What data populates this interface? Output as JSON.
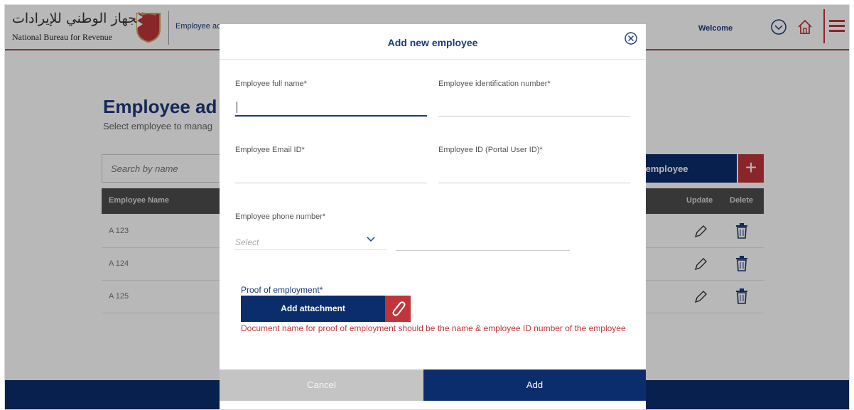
{
  "header": {
    "logo_arabic": "الجهاز الوطني للإيرادات",
    "logo_english": "National Bureau for Revenue",
    "subtitle": "Employee ac",
    "welcome": "Welcome",
    "icons": [
      "user-circle-icon",
      "home-icon",
      "hamburger-menu-icon"
    ]
  },
  "background_page": {
    "title": "Employee ad",
    "subtitle": "Select employee to manag",
    "search_placeholder": "Search by name",
    "add_button": "d employee",
    "add_plus": "+",
    "table": {
      "headers": [
        "Employee Name",
        "Update",
        "Delete"
      ],
      "rows": [
        {
          "name": "A 123"
        },
        {
          "name": "A 124"
        },
        {
          "name": "A 125"
        }
      ]
    }
  },
  "modal": {
    "title": "Add new employee",
    "fields": {
      "full_name": {
        "label": "Employee full name*",
        "value": ""
      },
      "identification_number": {
        "label": "Employee identification number*",
        "value": ""
      },
      "email": {
        "label": "Employee Email ID*",
        "value": ""
      },
      "portal_user_id": {
        "label": "Employee ID (Portal User ID)*",
        "value": ""
      },
      "phone": {
        "label": "Employee phone number*",
        "code_select": "Select",
        "value": ""
      }
    },
    "proof_label": "Proof of employment*",
    "attach_button": "Add attachment",
    "warning": "Document name for proof of employment should be the name & employee ID number of the employee",
    "cancel_button": "Cancel",
    "add_button": "Add"
  },
  "colors": {
    "brand_blue": "#0b2d6b",
    "accent_red": "#c0353b",
    "title_blue": "#1b3a7a"
  }
}
